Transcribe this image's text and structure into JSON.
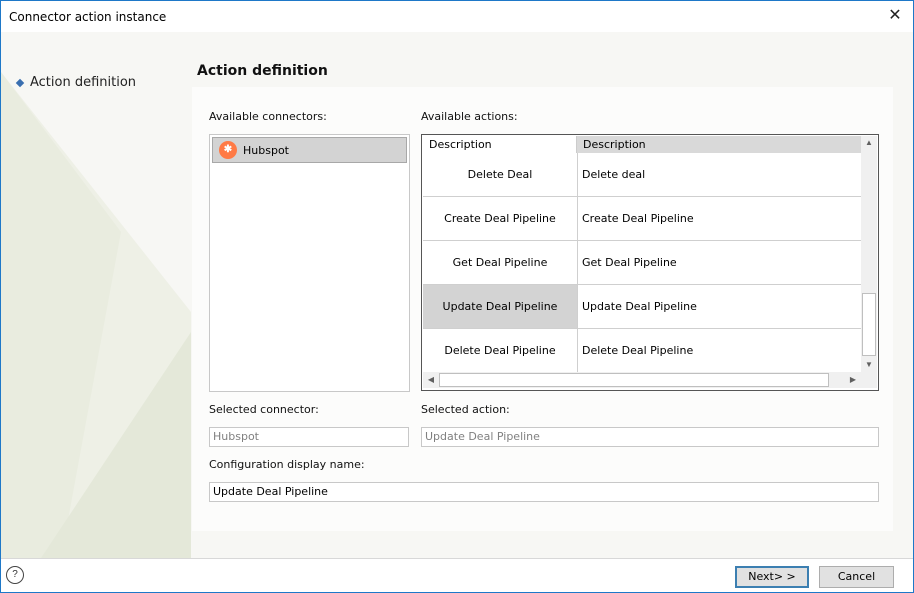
{
  "window": {
    "title": "Connector action instance"
  },
  "nav": {
    "items": [
      {
        "label": "Action definition"
      }
    ]
  },
  "heading": "Action definition",
  "connectors": {
    "label": "Available connectors:",
    "items": [
      {
        "label": "Hubspot",
        "icon": "hubspot-icon"
      }
    ]
  },
  "actions": {
    "label": "Available actions:",
    "columns": [
      "Description",
      "Description"
    ],
    "rows": [
      {
        "name": "Delete Deal",
        "description": "Delete deal"
      },
      {
        "name": "Create Deal Pipeline",
        "description": "Create Deal Pipeline"
      },
      {
        "name": "Get Deal Pipeline",
        "description": "Get Deal Pipeline"
      },
      {
        "name": "Update Deal Pipeline",
        "description": "Update Deal Pipeline"
      },
      {
        "name": "Delete Deal Pipeline",
        "description": "Delete Deal Pipeline"
      }
    ]
  },
  "selected_connector": {
    "label": "Selected connector:",
    "value": "Hubspot"
  },
  "selected_action": {
    "label": "Selected action:",
    "value": "Update Deal Pipeline"
  },
  "config_name": {
    "label": "Configuration display name:",
    "value": "Update Deal Pipeline"
  },
  "buttons": {
    "next": "Next> >",
    "cancel": "Cancel"
  },
  "colors": {
    "accent": "#1e78c8",
    "selection": "#d3d3d3",
    "hubspot": "#ff7a45"
  }
}
